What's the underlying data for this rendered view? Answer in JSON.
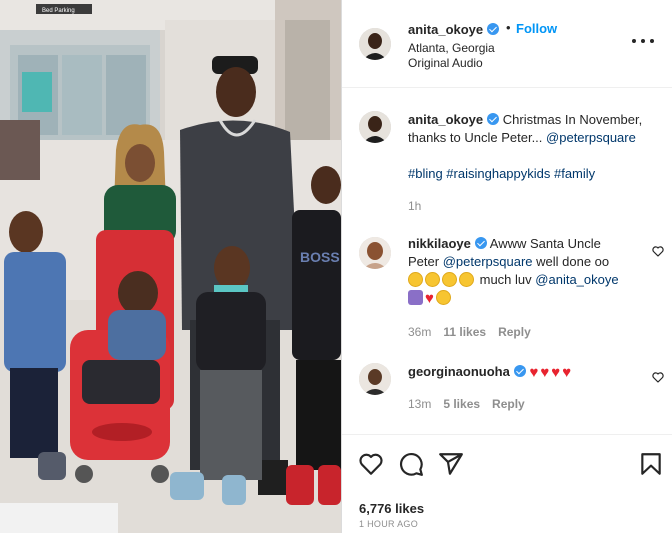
{
  "post": {
    "username": "anita_okoye",
    "follow_label": "Follow",
    "dot": "•",
    "location": "Atlanta, Georgia",
    "audio": "Original Audio"
  },
  "photo": {
    "sign_text": "Bed Parking",
    "shirt_text": "BOSS"
  },
  "caption": {
    "username": "anita_okoye",
    "text": "Christmas In November, thanks to Uncle Peter...",
    "mention": "@peterpsquare",
    "hashtags": "#bling #raisinghappykids #family",
    "time": "1h"
  },
  "comments": [
    {
      "username": "nikkilaoye",
      "text_1": "Awww Santa Uncle",
      "text_2": "Peter",
      "mention_1": "@peterpsquare",
      "text_3": "well done oo",
      "text_4": "much luv",
      "mention_2": "@anita_okoye",
      "time": "36m",
      "likes": "11 likes",
      "reply": "Reply"
    },
    {
      "username": "georginaonuoha",
      "time": "13m",
      "likes": "5 likes",
      "reply": "Reply"
    }
  ],
  "actions": {
    "likes": "6,776 likes",
    "time_ago": "1 HOUR AGO"
  },
  "icons": {
    "verified": "verified-badge-icon",
    "more": "more-options-icon",
    "like": "heart-icon",
    "comment": "comment-icon",
    "share": "share-icon",
    "save": "bookmark-icon"
  },
  "colors": {
    "accent": "#0095f6",
    "verified": "#3897f0",
    "mention": "#00376b",
    "heart_emoji": "#e8232f"
  }
}
